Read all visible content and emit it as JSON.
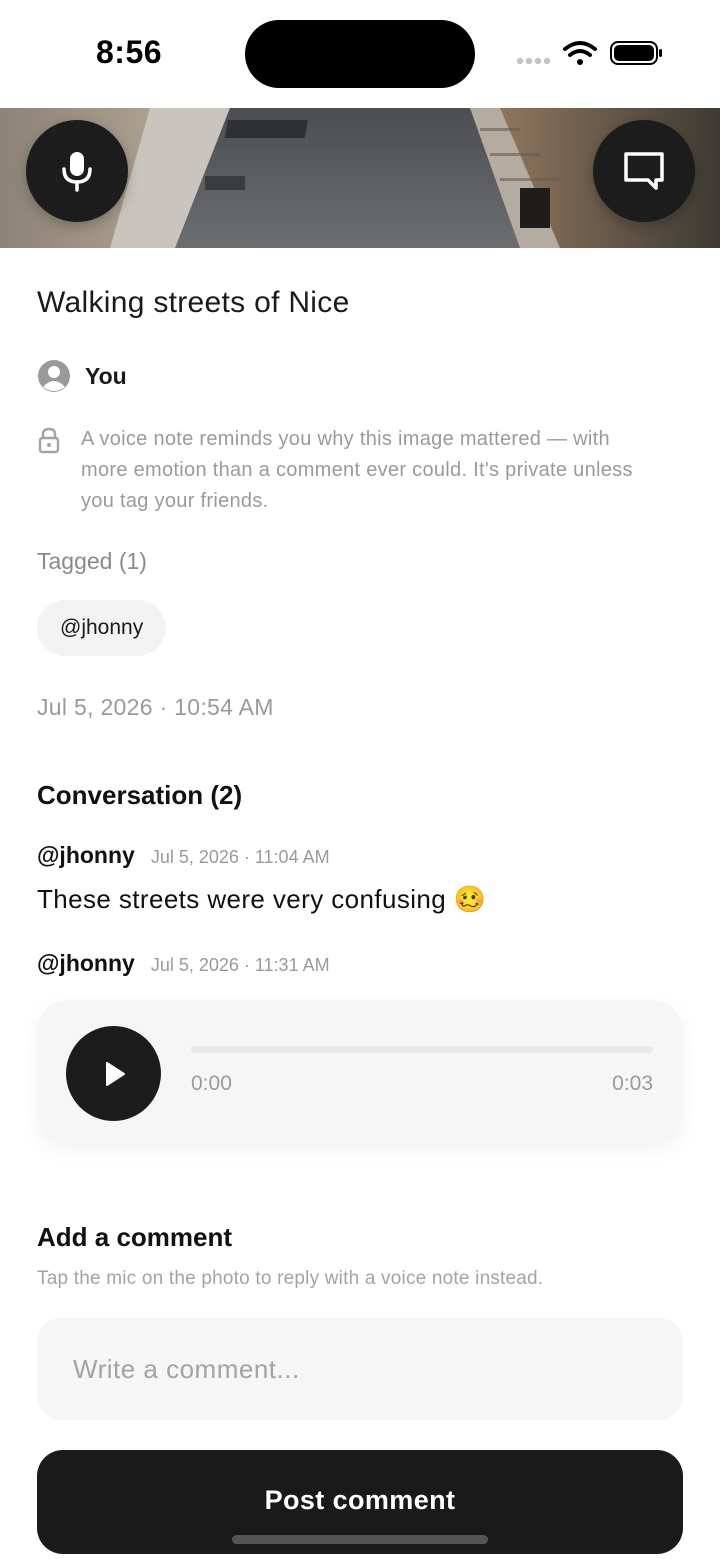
{
  "status_bar": {
    "time": "8:56"
  },
  "media": {
    "mic_icon": "microphone-icon",
    "comment_icon": "speech-bubble-icon"
  },
  "post": {
    "title": "Walking streets of Nice",
    "owner": "You",
    "privacy_note": "A voice note reminds you why this image mattered — with more emotion than a comment ever could. It's private unless you tag your friends.",
    "tagged_label": "Tagged (1)",
    "tags": [
      "@jhonny"
    ],
    "date": "Jul 5, 2026 · 10:54 AM"
  },
  "conversation": {
    "title": "Conversation (2)",
    "comments": [
      {
        "user": "@jhonny",
        "time": "Jul 5, 2026 · 11:04 AM",
        "text": "These streets were very confusing 🥴"
      },
      {
        "user": "@jhonny",
        "time": "Jul 5, 2026 · 11:31 AM",
        "audio": {
          "current": "0:00",
          "duration": "0:03",
          "progress": 0
        }
      }
    ]
  },
  "add_comment": {
    "title": "Add a comment",
    "hint": "Tap the mic on the photo to reply with a voice note instead.",
    "placeholder": "Write a comment...",
    "button_label": "Post comment"
  },
  "colors": {
    "primary": "#1a1a1a",
    "muted_text": "#9a9a9a",
    "surface": "#f6f6f6"
  }
}
